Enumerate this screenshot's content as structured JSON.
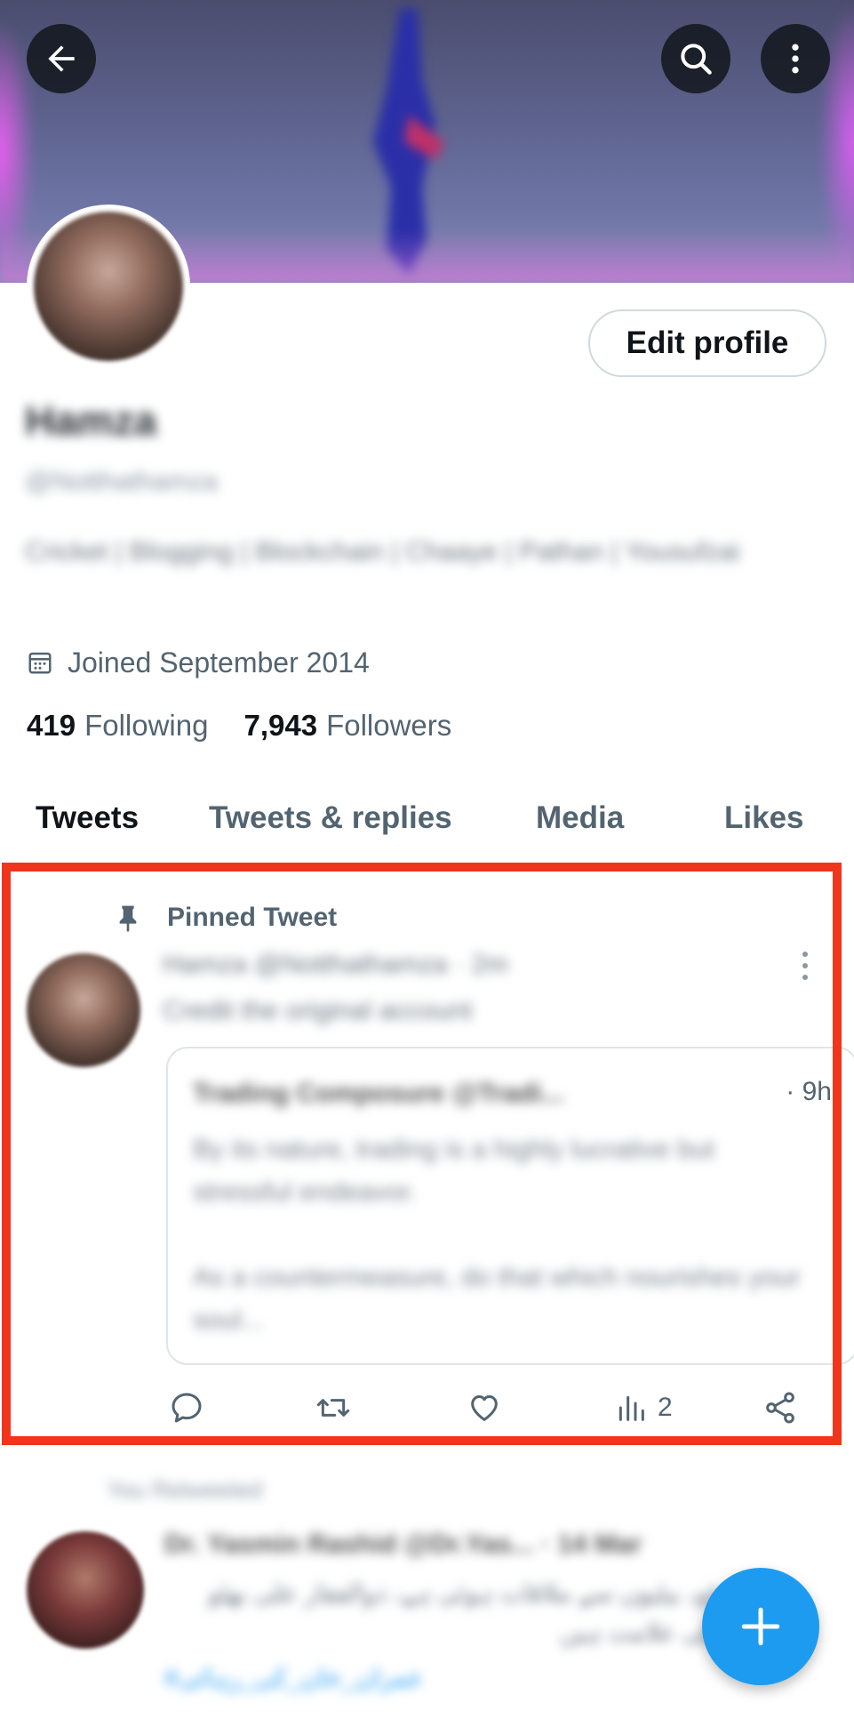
{
  "header": {
    "back_icon": "arrow-left-icon",
    "search_icon": "search-icon",
    "more_icon": "more-vertical-icon"
  },
  "profile": {
    "name": "Hamza",
    "handle": "@Notthathamza",
    "bio": "Cricket | Blogging | Blockchain | Chaaye | Pathan | Yousufzai",
    "joined": "Joined September 2014",
    "following_count": "419",
    "following_label": "Following",
    "followers_count": "7,943",
    "followers_label": "Followers",
    "edit_label": "Edit profile"
  },
  "tabs": [
    "Tweets",
    "Tweets & replies",
    "Media",
    "Likes"
  ],
  "pinned_tweet": {
    "pinned_label": "Pinned Tweet",
    "header": "Hamza @Notthathamza · 2m",
    "text": "Credit the original account",
    "quote": {
      "header": "Trading Composure @Tradi...",
      "time": "· 9h",
      "body": "By its nature, trading is a highly lucrative but stressful endeavor.\n\nAs a countermeasure, do that which nourishes your soul..."
    },
    "views": "2"
  },
  "next_tweet": {
    "retweet_label": "You Retweeted",
    "header": "Dr. Yasmin Rashid @Dr.Yas... · 14 Mar",
    "text": "میرے بیٹو، بیٹیوں سے ملاقات ہوئی ہے، ذوالفقار علی بھٹو انقلاب کی علامت ہیں",
    "hashtag": "#عمران_خان_کی_رہائی"
  },
  "colors": {
    "accent": "#1d9bf0",
    "highlight": "#f0351c",
    "text_secondary": "#536471"
  }
}
